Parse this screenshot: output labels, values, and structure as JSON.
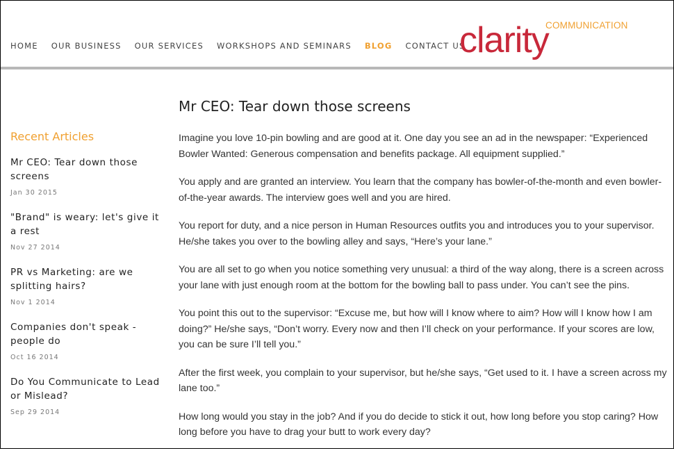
{
  "nav": {
    "items": [
      {
        "label": "HOME"
      },
      {
        "label": "OUR BUSINESS"
      },
      {
        "label": "OUR SERVICES"
      },
      {
        "label": "WORKSHOPS AND SEMINARS"
      },
      {
        "label": "BLOG",
        "active": true
      },
      {
        "label": "CONTACT US"
      }
    ]
  },
  "logo": {
    "word": "clarity",
    "tag": "COMMUNICATION",
    "color": "#c8283a",
    "accent": "#f0a030"
  },
  "sidebar": {
    "heading": "Recent Articles",
    "articles": [
      {
        "title": "Mr CEO: Tear down those screens",
        "date": "Jan 30 2015"
      },
      {
        "title": "\"Brand\" is weary: let's give it a rest",
        "date": "Nov 27 2014"
      },
      {
        "title": "PR vs Marketing: are we splitting hairs?",
        "date": "Nov 1 2014"
      },
      {
        "title": "Companies don't speak - people do",
        "date": "Oct 16 2014"
      },
      {
        "title": "Do You Communicate to Lead or Mislead?",
        "date": "Sep 29 2014"
      }
    ]
  },
  "post": {
    "title": "Mr CEO: Tear down those screens",
    "paragraphs": [
      "Imagine you love 10-pin bowling and are good at it. One day you see an ad in the newspaper: “Experienced Bowler Wanted: Generous compensation and benefits package. All equipment supplied.”",
      "You apply and are granted an interview. You learn that the company has bowler-of-the-month and even bowler-of-the-year awards.  The interview goes well and you are hired.",
      "You report for duty, and a nice person in Human Resources outfits you and introduces you to your supervisor. He/she takes you over to the bowling alley and says, “Here’s your lane.”",
      "You are all set to go when you notice something very unusual: a third of the way along, there is a screen across your lane with just enough room at the bottom for the bowling ball to pass under. You can’t see the pins.",
      "You point this out to the supervisor: “Excuse me, but how will I know where to aim? How will I know how I am doing?” He/she says, “Don’t worry.  Every now and then I’ll check on your performance. If your scores are low, you can be sure I’ll tell you.”",
      "After the first week, you complain to your supervisor, but he/she says, “Get used to it. I have a screen across my lane too.”",
      "How long would you stay in the job? And if you do decide to stick it out, how long before you stop caring? How long before you have to drag your butt to work every day?"
    ]
  }
}
